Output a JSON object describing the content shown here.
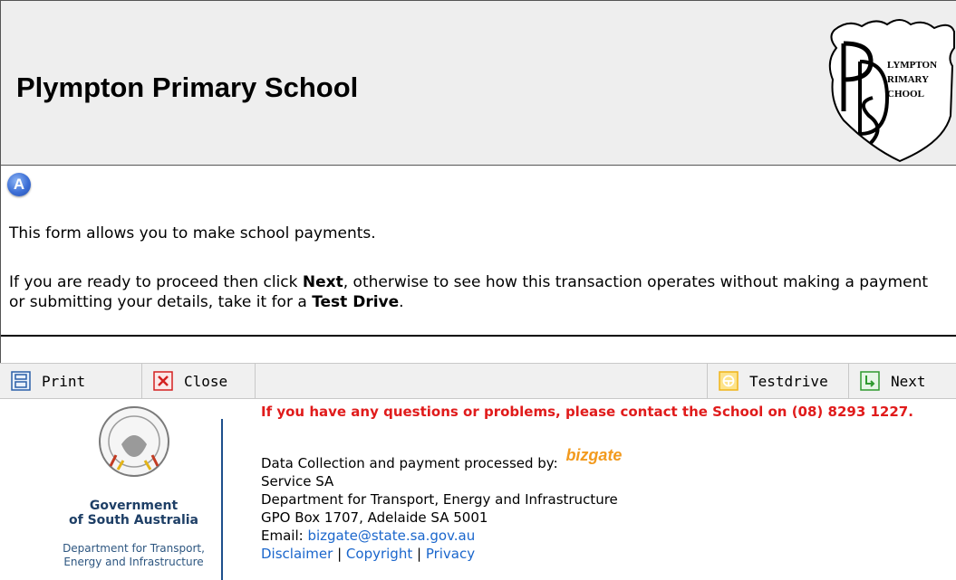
{
  "header": {
    "title": "Plympton Primary School",
    "crest_text": [
      "LYMPTON",
      "RIMARY",
      "CHOOL"
    ]
  },
  "step": {
    "icon_letter": "A"
  },
  "intro": {
    "line1": "This form allows you to make school payments.",
    "line2_pre": "If you are ready to proceed then click ",
    "line2_next": "Next",
    "line2_mid": ", otherwise to see how this transaction operates without making a payment or submitting your details, take it for a ",
    "line2_test": "Test Drive",
    "line2_end": "."
  },
  "toolbar": {
    "print_label": "Print",
    "close_label": "Close",
    "testdrive_label": "Testdrive",
    "next_label": "Next"
  },
  "footer": {
    "contact": "If you have any questions or problems, please contact the School on (08) 8293 1227.",
    "processed_by": "Data Collection and payment processed by:",
    "bizgate_logo": "bizgate",
    "org": "Service SA",
    "dept": "Department for Transport, Energy and Infrastructure",
    "address": "GPO Box 1707, Adelaide SA 5001",
    "email_label": "Email: ",
    "email": "bizgate@state.sa.gov.au",
    "links": [
      "Disclaimer",
      "Copyright",
      "Privacy"
    ],
    "gov_line1": "Government",
    "gov_line2": "of South Australia",
    "gov_dept1": "Department for Transport,",
    "gov_dept2": "Energy and Infrastructure"
  },
  "colors": {
    "contact_red": "#e01b1b",
    "link_blue": "#1a66cc",
    "gov_blue": "#1e3f66",
    "bizgate_orange": "#f29a1e"
  }
}
